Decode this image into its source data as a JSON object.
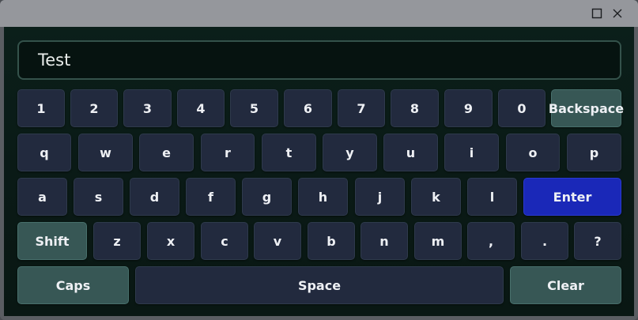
{
  "window": {
    "maximize_icon": "maximize-icon",
    "close_icon": "close-icon"
  },
  "display": {
    "value": "Test"
  },
  "rows": {
    "r1": [
      "1",
      "2",
      "3",
      "4",
      "5",
      "6",
      "7",
      "8",
      "9",
      "0"
    ],
    "r1_special": "Backspace",
    "r2": [
      "q",
      "w",
      "e",
      "r",
      "t",
      "y",
      "u",
      "i",
      "o",
      "p"
    ],
    "r3": [
      "a",
      "s",
      "d",
      "f",
      "g",
      "h",
      "j",
      "k",
      "l"
    ],
    "r3_special": "Enter",
    "r4_special": "Shift",
    "r4": [
      "z",
      "x",
      "c",
      "v",
      "b",
      "n",
      "m",
      ",",
      ".",
      "?"
    ],
    "r5": {
      "caps": "Caps",
      "space": "Space",
      "clear": "Clear"
    }
  },
  "colors": {
    "background": "#0b1f1a",
    "key": "#222a3e",
    "special_key": "#375755",
    "enter_key": "#1a28b8",
    "titlebar": "#95979c"
  }
}
